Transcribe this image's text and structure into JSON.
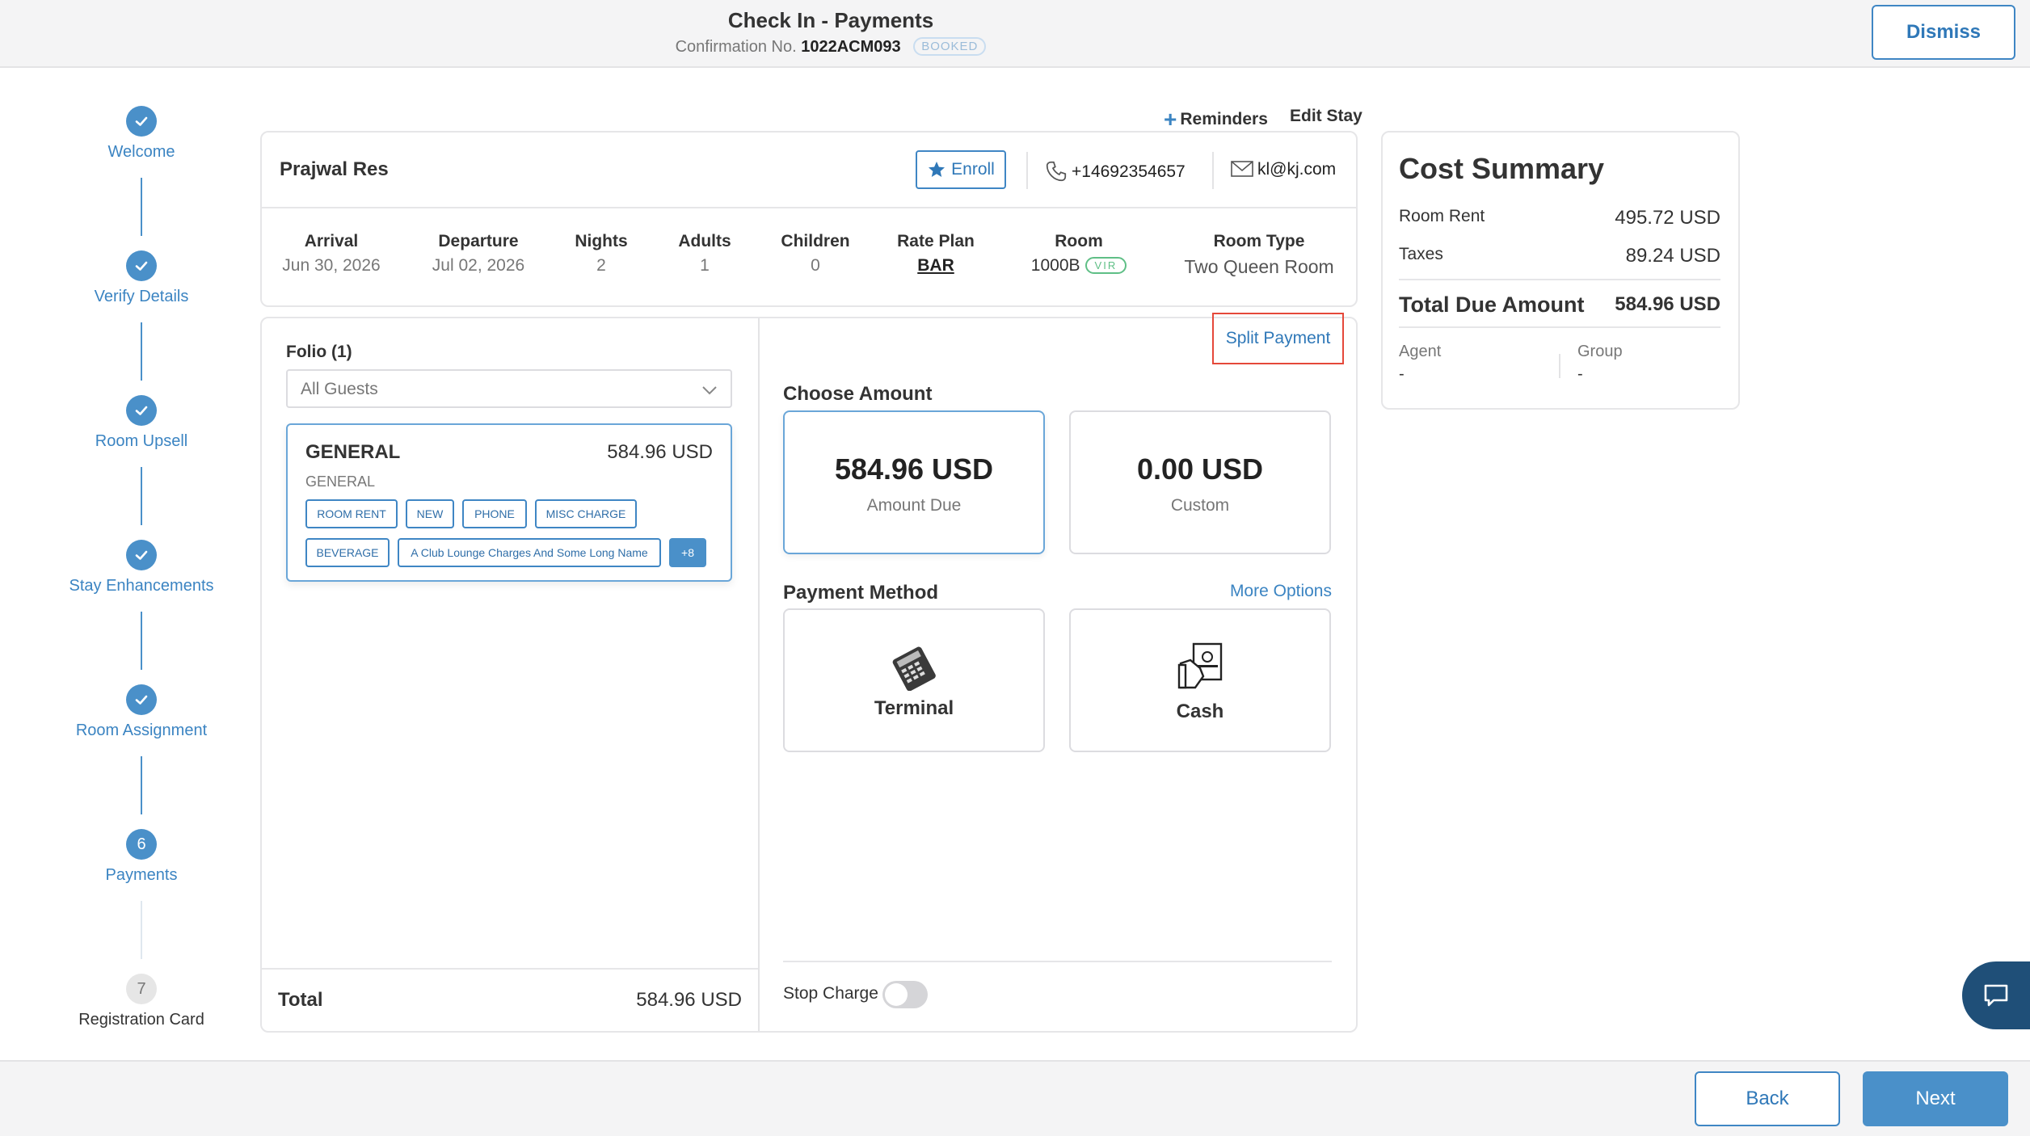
{
  "header": {
    "title": "Check In - Payments",
    "confirmation_label": "Confirmation No.",
    "confirmation_number": "1022ACM093",
    "status": "BOOKED",
    "dismiss": "Dismiss"
  },
  "stepper": [
    {
      "label": "Welcome",
      "state": "done"
    },
    {
      "label": "Verify Details",
      "state": "done"
    },
    {
      "label": "Room Upsell",
      "state": "done"
    },
    {
      "label": "Stay Enhancements",
      "state": "done"
    },
    {
      "label": "Room Assignment",
      "state": "done"
    },
    {
      "label": "Payments",
      "state": "current",
      "number": "6"
    },
    {
      "label": "Registration Card",
      "state": "upcoming",
      "number": "7"
    }
  ],
  "top_links": {
    "reminders": "Reminders",
    "edit_stay": "Edit Stay"
  },
  "guest": {
    "name": "Prajwal Res",
    "enroll": "Enroll",
    "phone": "+14692354657",
    "email": "kl@kj.com"
  },
  "stay": {
    "arrival": {
      "label": "Arrival",
      "value": "Jun 30, 2026"
    },
    "departure": {
      "label": "Departure",
      "value": "Jul 02, 2026"
    },
    "nights": {
      "label": "Nights",
      "value": "2"
    },
    "adults": {
      "label": "Adults",
      "value": "1"
    },
    "children": {
      "label": "Children",
      "value": "0"
    },
    "rate_plan": {
      "label": "Rate Plan",
      "value": "BAR"
    },
    "room": {
      "label": "Room",
      "value": "1000B",
      "badge": "VIR"
    },
    "room_type": {
      "label": "Room Type",
      "value": "Two Queen Room"
    }
  },
  "folio": {
    "label": "Folio (1)",
    "select_value": "All Guests",
    "card": {
      "name": "GENERAL",
      "amount": "584.96 USD",
      "subtitle": "GENERAL",
      "tags": [
        "ROOM RENT",
        "NEW",
        "PHONE",
        "MISC CHARGE",
        "BEVERAGE",
        "A Club Lounge Charges And Some Long Name"
      ],
      "more": "+8"
    },
    "total_label": "Total",
    "total_value": "584.96 USD"
  },
  "payment": {
    "split_payment": "Split Payment",
    "choose_amount": "Choose Amount",
    "amount_due": {
      "value": "584.96 USD",
      "label": "Amount Due"
    },
    "custom": {
      "value": "0.00 USD",
      "label": "Custom"
    },
    "method_label": "Payment Method",
    "more_options": "More Options",
    "methods": [
      "Terminal",
      "Cash"
    ],
    "stop_charge": "Stop Charge"
  },
  "cost_summary": {
    "title": "Cost Summary",
    "rows": [
      {
        "label": "Room Rent",
        "value": "495.72 USD"
      },
      {
        "label": "Taxes",
        "value": "89.24 USD"
      }
    ],
    "total_label": "Total Due Amount",
    "total_value": "584.96 USD",
    "agent_label": "Agent",
    "agent_value": "-",
    "group_label": "Group",
    "group_value": "-"
  },
  "footer": {
    "back": "Back",
    "next": "Next"
  },
  "colors": {
    "accent": "#4a90c9",
    "highlight_border": "#e5483a",
    "vip": "#5fbf86"
  }
}
